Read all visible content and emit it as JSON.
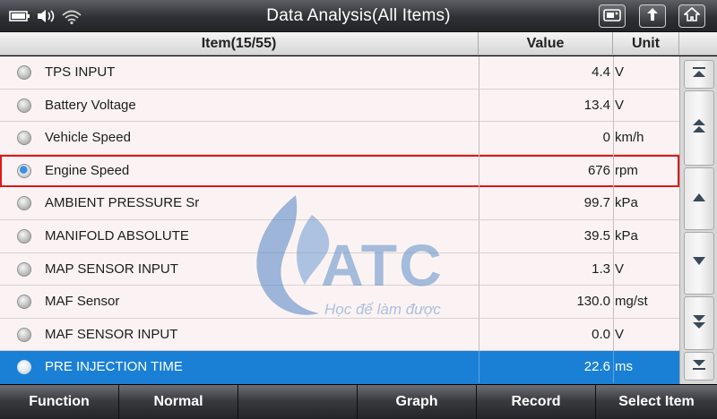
{
  "title": "Data Analysis(All Items)",
  "header": {
    "item": "Item(15/55)",
    "value": "Value",
    "unit": "Unit"
  },
  "rows": [
    {
      "name": "TPS INPUT",
      "value": "4.4",
      "unit": "V",
      "state": "normal"
    },
    {
      "name": "Battery Voltage",
      "value": "13.4",
      "unit": "V",
      "state": "normal"
    },
    {
      "name": "Vehicle Speed",
      "value": "0",
      "unit": "km/h",
      "state": "normal"
    },
    {
      "name": "Engine Speed",
      "value": "676",
      "unit": "rpm",
      "state": "checked"
    },
    {
      "name": "AMBIENT PRESSURE Sr",
      "value": "99.7",
      "unit": "kPa",
      "state": "normal"
    },
    {
      "name": "MANIFOLD ABSOLUTE",
      "value": "39.5",
      "unit": "kPa",
      "state": "normal"
    },
    {
      "name": "MAP SENSOR INPUT",
      "value": "1.3",
      "unit": "V",
      "state": "normal"
    },
    {
      "name": "MAF Sensor",
      "value": "130.0",
      "unit": "mg/st",
      "state": "normal"
    },
    {
      "name": "MAF SENSOR INPUT",
      "value": "0.0",
      "unit": "V",
      "state": "normal"
    },
    {
      "name": "PRE INJECTION TIME",
      "value": "22.6",
      "unit": "ms",
      "state": "highlighted"
    }
  ],
  "watermark": {
    "logo_text": "ATC",
    "slogan": "Học để làm được"
  },
  "toolbar": {
    "function": "Function",
    "normal": "Normal",
    "blank": "",
    "graph": "Graph",
    "record": "Record",
    "select_item": "Select Item"
  },
  "colors": {
    "highlight": "#1a80d6",
    "selection_border": "#e01818",
    "row_bg": "#fbf3f3"
  },
  "icons": {
    "status": [
      "battery-icon",
      "volume-icon",
      "wifi-icon"
    ],
    "nav": [
      "screenshot-icon",
      "back-icon",
      "home-icon"
    ],
    "scroll": [
      "scroll-top-icon",
      "page-up-icon",
      "line-up-icon",
      "line-down-icon",
      "page-down-icon",
      "scroll-bottom-icon"
    ]
  }
}
